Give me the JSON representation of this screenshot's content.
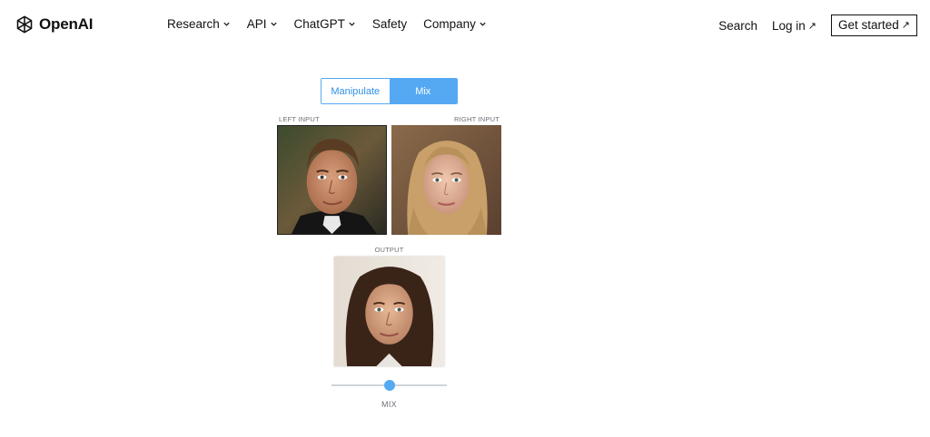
{
  "header": {
    "logo_text": "OpenAI",
    "nav": [
      {
        "label": "Research",
        "has_dropdown": true
      },
      {
        "label": "API",
        "has_dropdown": true
      },
      {
        "label": "ChatGPT",
        "has_dropdown": true
      },
      {
        "label": "Safety",
        "has_dropdown": false
      },
      {
        "label": "Company",
        "has_dropdown": true
      }
    ],
    "search_label": "Search",
    "login_label": "Log in",
    "login_arrow": "↗",
    "get_started_label": "Get started",
    "get_started_arrow": "↗"
  },
  "toggle": {
    "options": [
      "Manipulate",
      "Mix"
    ],
    "active": "Mix"
  },
  "inputs": {
    "left_caption": "LEFT INPUT",
    "right_caption": "RIGHT INPUT",
    "output_caption": "OUTPUT"
  },
  "mix": {
    "label": "MIX",
    "value": 0.5
  },
  "colors": {
    "accent": "#55a9f3",
    "accent_text": "#2d8fe6",
    "caption": "#6b6f76"
  }
}
